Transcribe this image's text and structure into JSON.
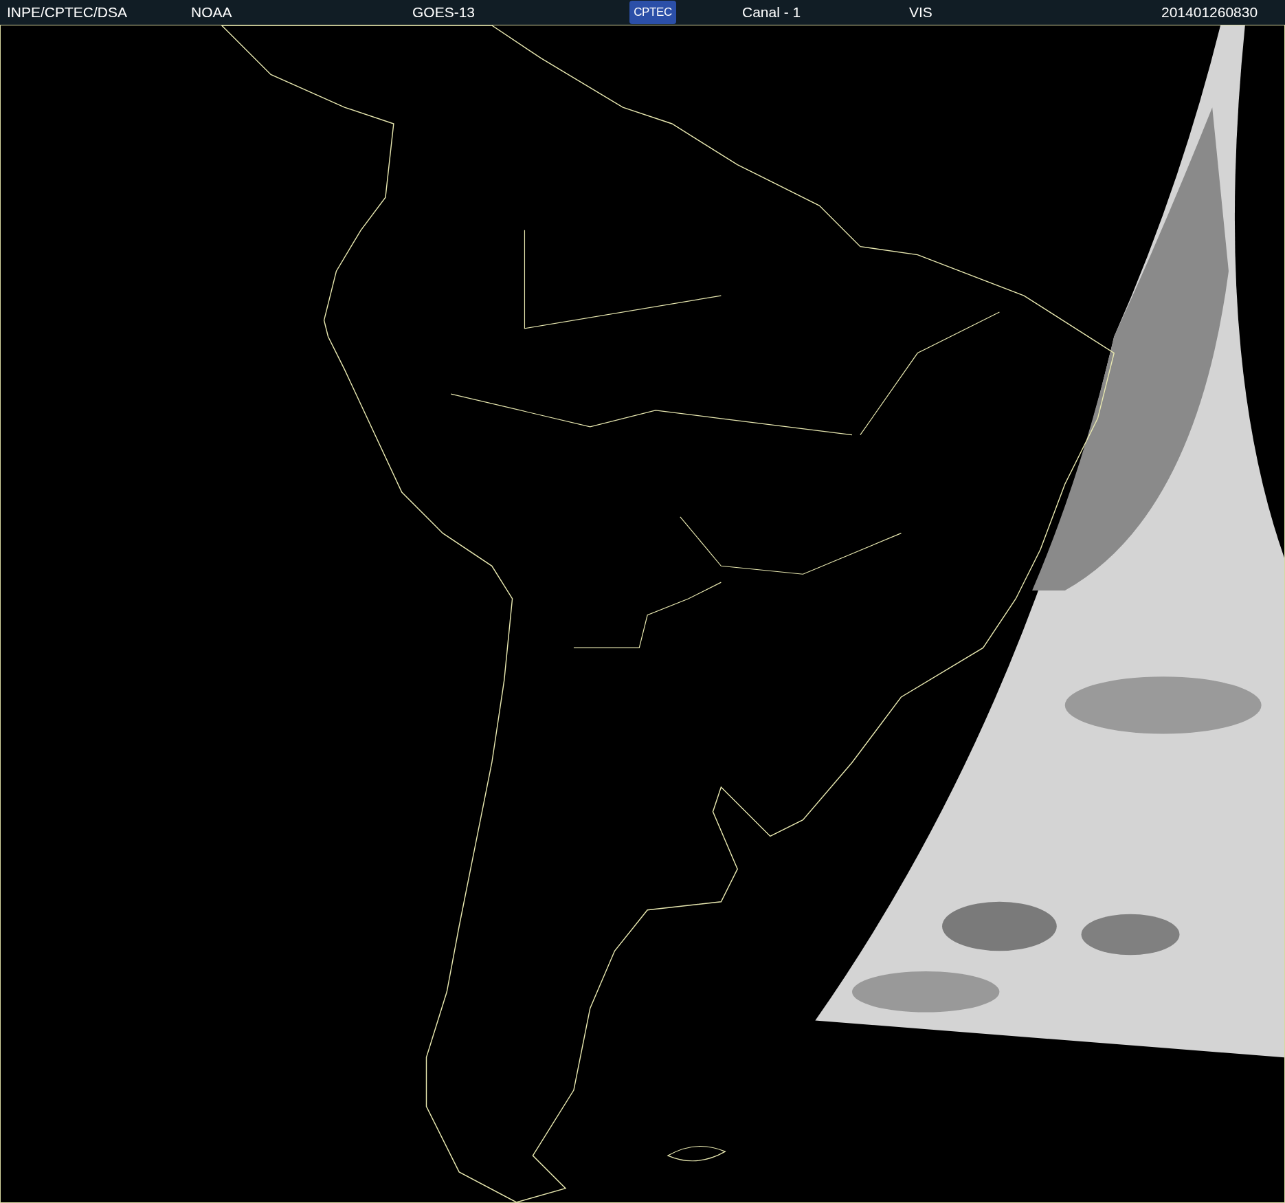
{
  "header": {
    "items": [
      {
        "kind": "text",
        "text": "INPE/CPTEC/DSA"
      },
      {
        "kind": "text",
        "text": "NOAA"
      },
      {
        "kind": "text",
        "text": "GOES-13"
      },
      {
        "kind": "logo",
        "text": "CPTEC"
      },
      {
        "kind": "text",
        "text": "Canal - 1"
      },
      {
        "kind": "text",
        "text": "VIS"
      },
      {
        "kind": "text",
        "text": "201401260830"
      }
    ]
  }
}
